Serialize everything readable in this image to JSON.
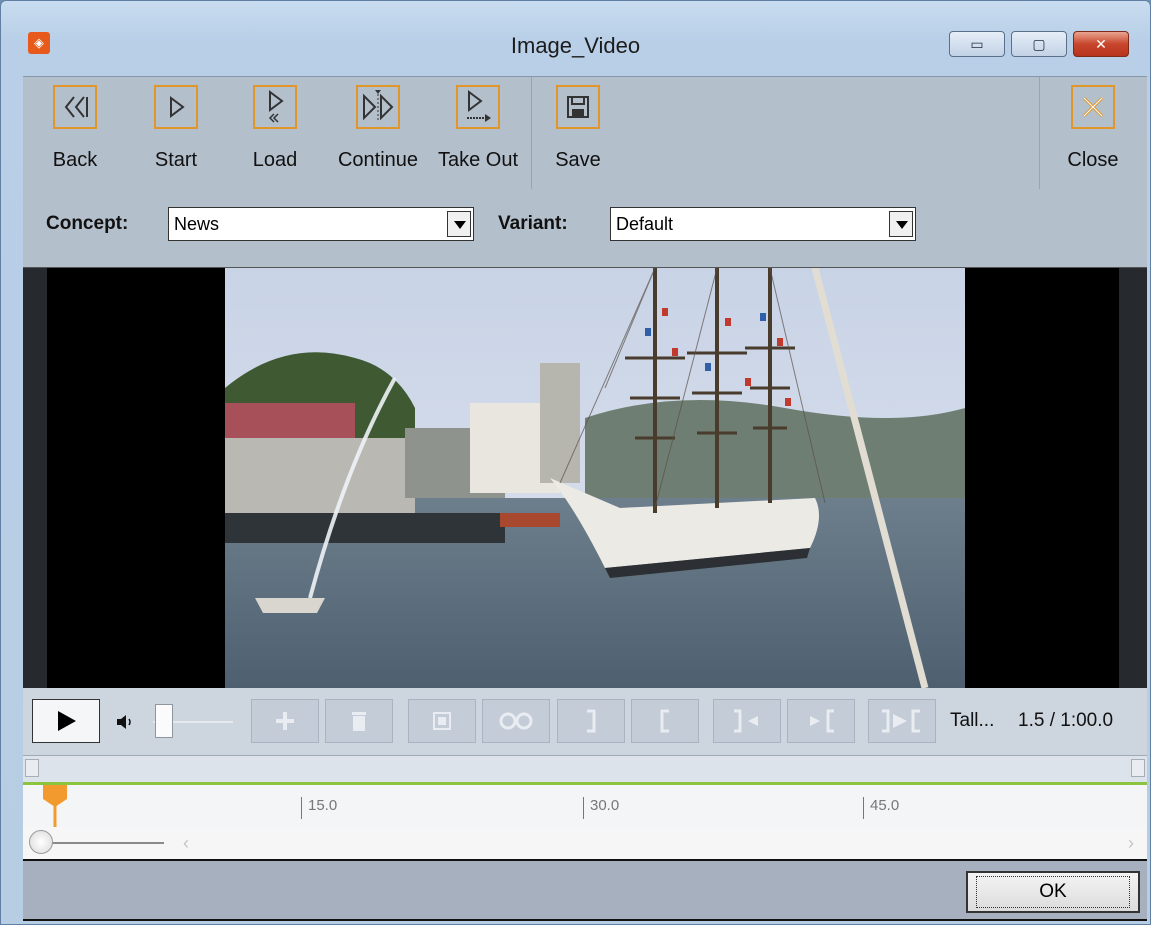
{
  "window": {
    "title": "Image_Video",
    "minimize_glyph": "▭",
    "maximize_glyph": "▢",
    "close_glyph": "✕"
  },
  "toolbar": {
    "buttons": [
      {
        "label": "Back",
        "icon": "rewind-icon"
      },
      {
        "label": "Start",
        "icon": "play-triangle-icon"
      },
      {
        "label": "Load",
        "icon": "load-icon"
      },
      {
        "label": "Continue",
        "icon": "continue-icon"
      },
      {
        "label": "Take Out",
        "icon": "take-out-icon"
      },
      {
        "label": "Save",
        "icon": "floppy-disk-icon"
      },
      {
        "label": "Close",
        "icon": "close-x-icon"
      }
    ],
    "accent_color": "#e0962b"
  },
  "concept": {
    "label": "Concept:",
    "value": "News"
  },
  "variant": {
    "label": "Variant:",
    "value": "Default"
  },
  "playback": {
    "status_name": "Tall...",
    "position": "1.5 / 1:00.0"
  },
  "timeline": {
    "ticks": [
      "15.0",
      "30.0",
      "45.0"
    ],
    "accent_color": "#8dc43f",
    "playhead_color": "#f29a2e"
  },
  "footer": {
    "ok_label": "OK"
  }
}
